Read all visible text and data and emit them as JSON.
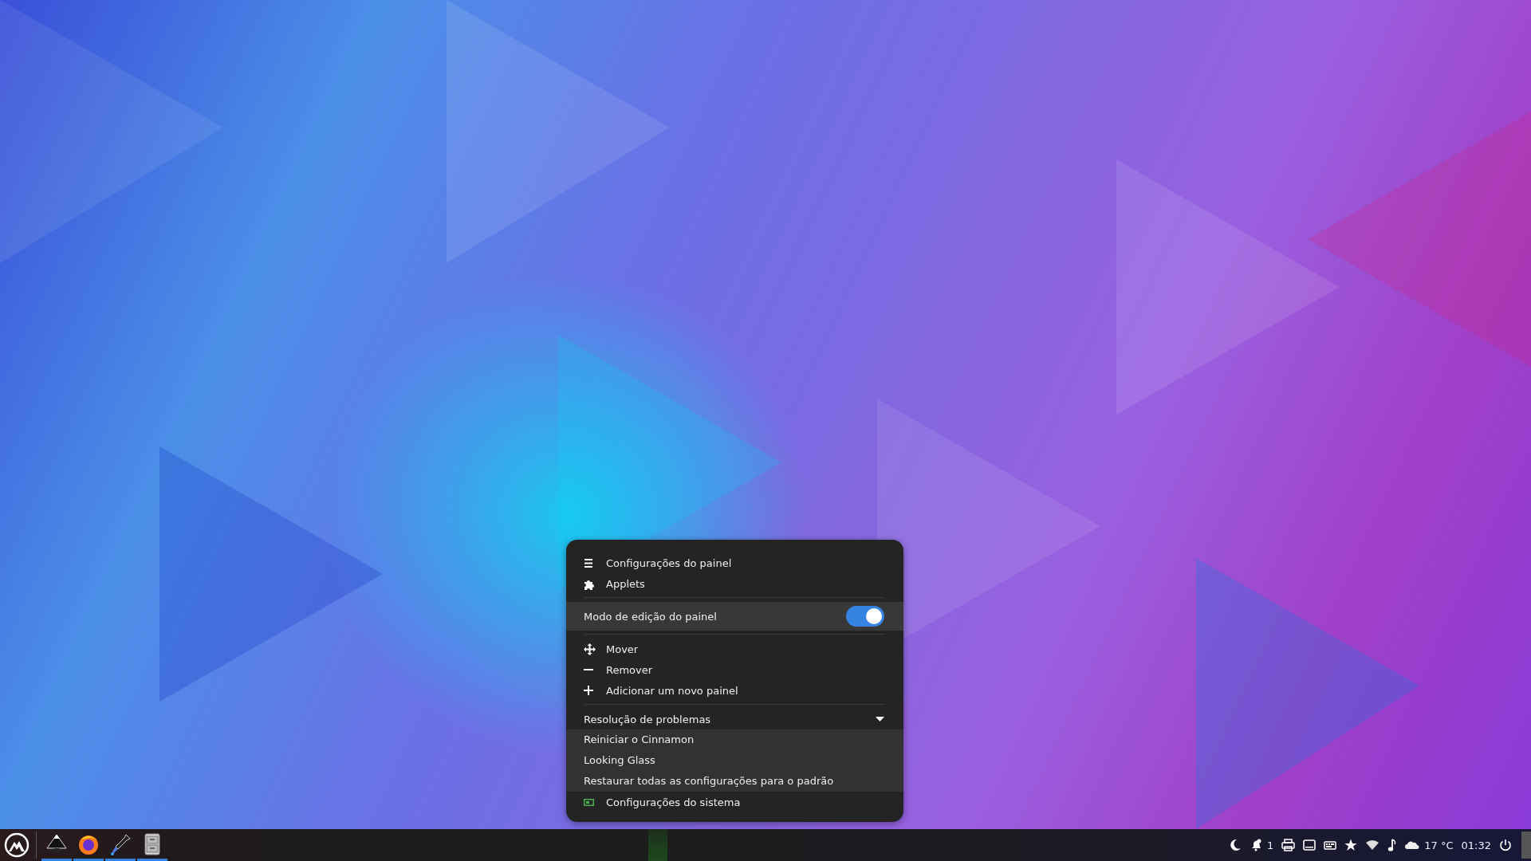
{
  "menu": {
    "top_items": [
      {
        "label": "Configurações do painel"
      },
      {
        "label": "Applets"
      }
    ],
    "edit_mode": {
      "label": "Modo de edição do painel",
      "on": true,
      "highlighted": true
    },
    "panel_items": [
      {
        "label": "Mover"
      },
      {
        "label": "Remover"
      },
      {
        "label": "Adicionar um novo painel"
      }
    ],
    "troubleshooting": {
      "label": "Resolução de problemas",
      "expanded": true,
      "items": [
        {
          "label": "Reiniciar o Cinnamon"
        },
        {
          "label": "Looking Glass"
        },
        {
          "label": "Restaurar todas as configurações para o padrão"
        }
      ]
    },
    "bottom_items": [
      {
        "label": "Configurações do sistema"
      }
    ]
  },
  "taskbar": {
    "launchers": [
      {
        "running": true
      },
      {
        "running": true
      },
      {
        "running": true
      },
      {
        "running": true
      }
    ],
    "notification_count": "1",
    "temperature": "17 °C",
    "clock": "01:32"
  }
}
